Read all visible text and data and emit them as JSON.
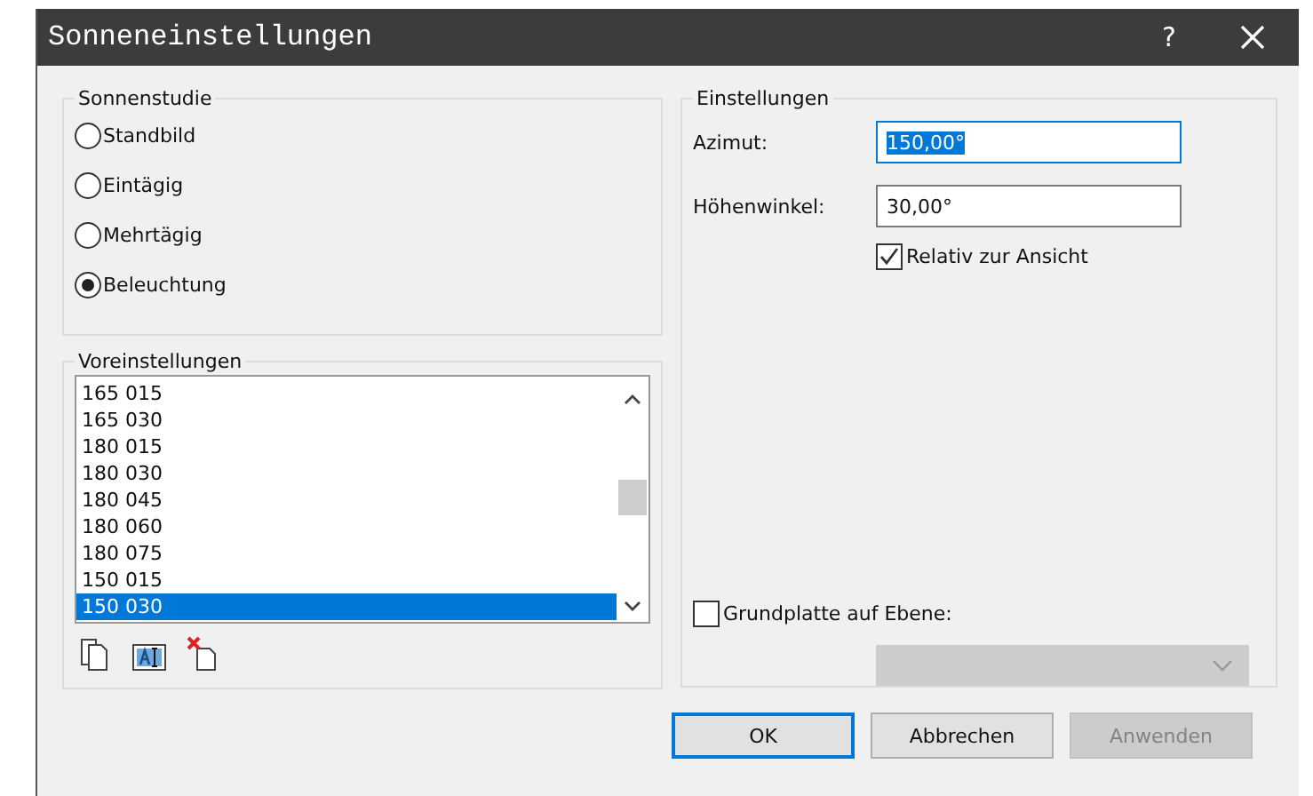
{
  "window": {
    "title": "Sonneneinstellungen",
    "help": "?"
  },
  "sun_study": {
    "label": "Sonnenstudie",
    "options": [
      {
        "label": "Standbild",
        "selected": false
      },
      {
        "label": "Eintägig",
        "selected": false
      },
      {
        "label": "Mehrtägig",
        "selected": false
      },
      {
        "label": "Beleuchtung",
        "selected": true
      }
    ]
  },
  "presets": {
    "label": "Voreinstellungen",
    "items": [
      {
        "label": "165 015",
        "selected": false
      },
      {
        "label": "165 030",
        "selected": false
      },
      {
        "label": "180 015",
        "selected": false
      },
      {
        "label": "180 030",
        "selected": false
      },
      {
        "label": "180 045",
        "selected": false
      },
      {
        "label": "180 060",
        "selected": false
      },
      {
        "label": "180 075",
        "selected": false
      },
      {
        "label": "150 015",
        "selected": false
      },
      {
        "label": "150 030",
        "selected": true
      }
    ]
  },
  "settings": {
    "label": "Einstellungen",
    "fields": [
      {
        "label": "Azimut:",
        "value": "150,00°",
        "focused": true
      },
      {
        "label": "Höhenwinkel:",
        "value": "30,00°",
        "focused": false
      }
    ],
    "relative": {
      "label": "Relativ zur Ansicht",
      "checked": true
    },
    "base_plane": {
      "label": "Grundplatte auf Ebene:",
      "checked": false
    },
    "level_dropdown": {
      "disabled": true
    }
  },
  "buttons": [
    {
      "label": "OK",
      "default": true,
      "disabled": false
    },
    {
      "label": "Abbrechen",
      "default": false,
      "disabled": false
    },
    {
      "label": "Anwenden",
      "default": false,
      "disabled": true
    }
  ]
}
